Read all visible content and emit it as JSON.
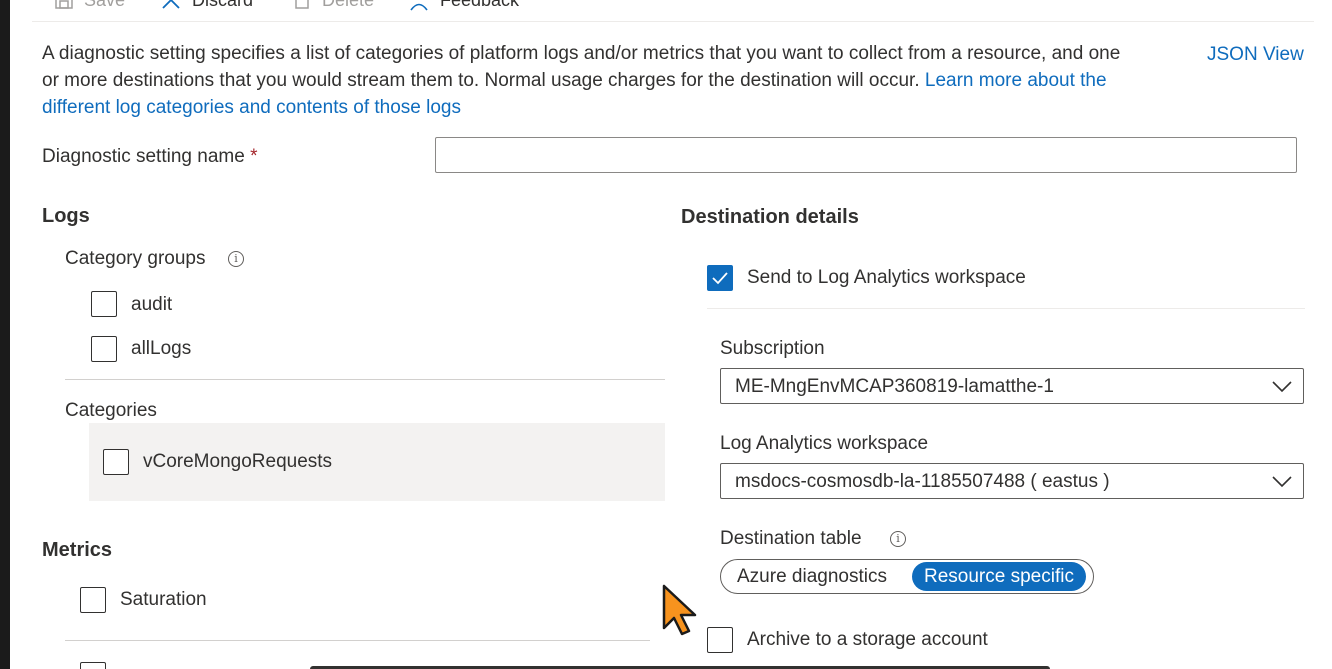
{
  "toolbar": {
    "save_label": "Save",
    "discard_label": "Discard",
    "delete_label": "Delete",
    "feedback_label": "Feedback"
  },
  "description": {
    "text": "A diagnostic setting specifies a list of categories of platform logs and/or metrics that you want to collect from a resource, and one or more destinations that you would stream them to. Normal usage charges for the destination will occur.",
    "link_text": "Learn more about the different log categories and contents of those logs"
  },
  "json_view_label": "JSON View",
  "setting_name": {
    "label": "Diagnostic setting name",
    "required_mark": "*",
    "value": ""
  },
  "logs": {
    "heading": "Logs",
    "category_groups_label": "Category groups",
    "category_groups": [
      {
        "label": "audit",
        "checked": false
      },
      {
        "label": "allLogs",
        "checked": false
      }
    ],
    "categories_label": "Categories",
    "categories": [
      {
        "label": "vCoreMongoRequests",
        "checked": false
      }
    ]
  },
  "metrics": {
    "heading": "Metrics",
    "items": [
      {
        "label": "Saturation",
        "checked": false
      }
    ]
  },
  "destination": {
    "heading": "Destination details",
    "send_to_log_analytics": {
      "label": "Send to Log Analytics workspace",
      "checked": true
    },
    "subscription": {
      "label": "Subscription",
      "value": "ME-MngEnvMCAP360819-lamatthe-1"
    },
    "workspace": {
      "label": "Log Analytics workspace",
      "value": "msdocs-cosmosdb-la-1185507488 ( eastus )"
    },
    "destination_table": {
      "label": "Destination table",
      "options": [
        "Azure diagnostics",
        "Resource specific"
      ],
      "selected": "Resource specific"
    },
    "archive_storage": {
      "label": "Archive to a storage account",
      "checked": false
    }
  },
  "colors": {
    "accent": "#0f6cbd",
    "text": "#323130",
    "required": "#a4262c",
    "cursor": "#f7931e"
  }
}
